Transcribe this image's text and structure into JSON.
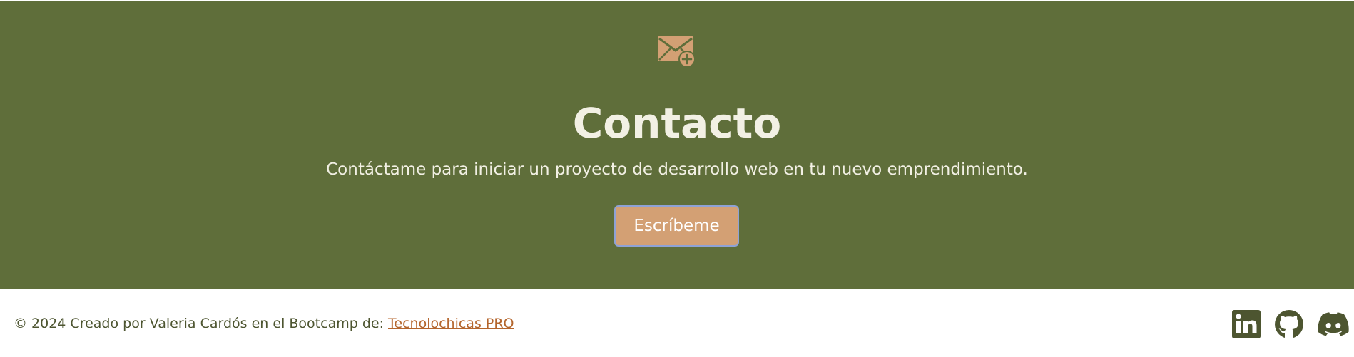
{
  "contact": {
    "icon": "envelope-plus-icon",
    "title": "Contacto",
    "subtitle": "Contáctame para iniciar un proyecto de desarrollo web en tu nuevo emprendimiento.",
    "button_label": "Escríbeme"
  },
  "footer": {
    "credit_text": "© 2024 Creado por Valeria Cardós en el Bootcamp de: ",
    "link_text": "Tecnolochicas PRO",
    "social": [
      {
        "name": "linkedin-icon"
      },
      {
        "name": "github-icon"
      },
      {
        "name": "discord-icon"
      }
    ]
  },
  "colors": {
    "section_background": "#5f6e3a",
    "accent": "#d3a074",
    "heading_text": "#f2f0e4",
    "footer_text": "#4d5530",
    "link": "#b4652c"
  }
}
